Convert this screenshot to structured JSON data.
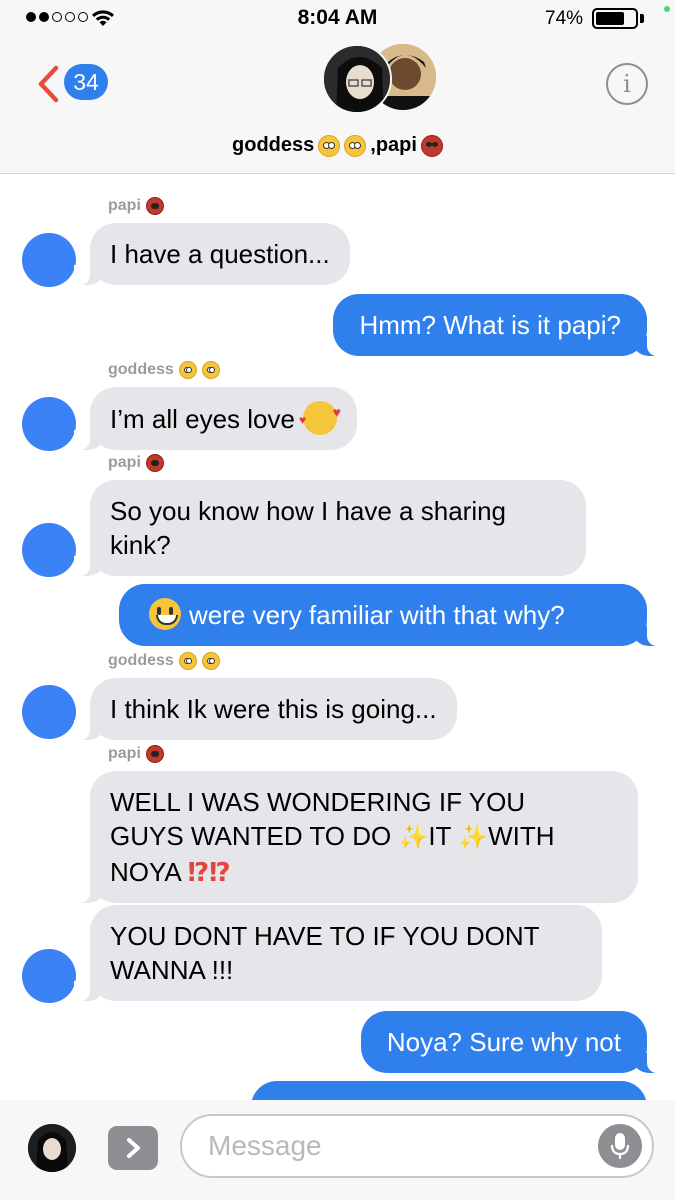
{
  "status_bar": {
    "time": "8:04 AM",
    "battery": "74%",
    "battery_level": 0.74,
    "signal_bars_filled": 2,
    "signal_bars_total": 5
  },
  "header": {
    "back_count": "34",
    "group_name": "goddess",
    "group_name_2": ",papi",
    "icons": [
      "chevron-left-icon",
      "info-icon"
    ]
  },
  "colors": {
    "accent": "#2f80ed",
    "incoming_bubble": "#e5e5ea",
    "sender_label": "#9b9b9b"
  },
  "messages": [
    {
      "direction": "in",
      "sender": "papi",
      "text": "I have a question..."
    },
    {
      "direction": "out",
      "text": "Hmm? What is it papi?"
    },
    {
      "direction": "in",
      "sender": "goddess",
      "text": "I’m all eyes love"
    },
    {
      "direction": "in",
      "sender": "papi",
      "line1": "So you know how I have a sharing",
      "line2": "kink?"
    },
    {
      "direction": "out",
      "text": "were very familiar with that why?"
    },
    {
      "direction": "in",
      "sender": "goddess",
      "text": "I think Ik were this is going..."
    },
    {
      "direction": "in",
      "sender": "papi",
      "line1": "WELL I WAS WONDERING IF YOU",
      "line2a": "GUYS WANTED TO DO ",
      "line2b": "IT",
      "line2c": "WITH",
      "line3": "NOYA"
    },
    {
      "direction": "in",
      "line1": "YOU DONT HAVE TO IF YOU DONT",
      "line2": "WANNA !!!"
    },
    {
      "direction": "out",
      "text": "Noya? Sure why not"
    }
  ],
  "input": {
    "placeholder": "Message"
  }
}
